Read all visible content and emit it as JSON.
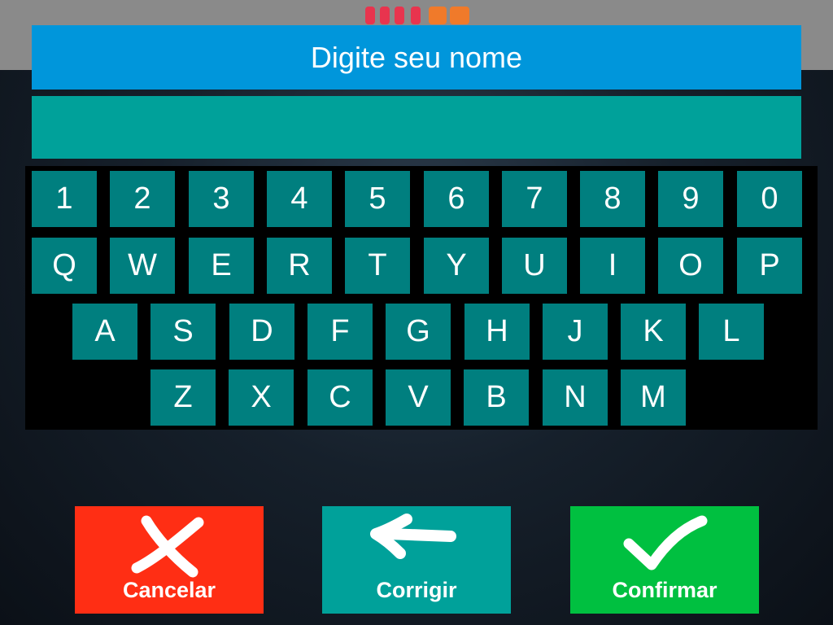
{
  "header": {
    "title": "Digite seu nome"
  },
  "name_input": {
    "value": ""
  },
  "keyboard": {
    "rows": [
      [
        "1",
        "2",
        "3",
        "4",
        "5",
        "6",
        "7",
        "8",
        "9",
        "0"
      ],
      [
        "Q",
        "W",
        "E",
        "R",
        "T",
        "Y",
        "U",
        "I",
        "O",
        "P"
      ],
      [
        "A",
        "S",
        "D",
        "F",
        "G",
        "H",
        "J",
        "K",
        "L"
      ],
      [
        "Z",
        "X",
        "C",
        "V",
        "B",
        "N",
        "M"
      ]
    ]
  },
  "actions": {
    "cancel_label": "Cancelar",
    "correct_label": "Corrigir",
    "confirm_label": "Confirmar"
  },
  "colors": {
    "title_bar": "#0096db",
    "input_field": "#00a19a",
    "key": "#007f7f",
    "cancel": "#ff2e14",
    "correct": "#00a19a",
    "confirm": "#00c040"
  },
  "icons": {
    "cancel": "x-icon",
    "correct": "arrow-left-icon",
    "confirm": "checkmark-icon"
  }
}
